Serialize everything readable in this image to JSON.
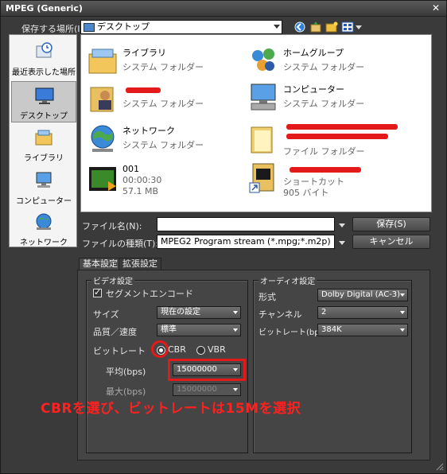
{
  "window": {
    "title": "MPEG (Generic)",
    "close_glyph": "✕"
  },
  "location": {
    "label": "保存する場所(I):",
    "value": "デスクトップ"
  },
  "places": [
    {
      "label": "最近表示した場所",
      "icon": "recent-places-icon"
    },
    {
      "label": "デスクトップ",
      "icon": "desktop-icon",
      "selected": true
    },
    {
      "label": "ライブラリ",
      "icon": "library-icon"
    },
    {
      "label": "コンピューター",
      "icon": "computer-icon"
    },
    {
      "label": "ネットワーク",
      "icon": "network-icon"
    }
  ],
  "files": [
    {
      "name": "ライブラリ",
      "type": "システム フォルダー",
      "icon": "library-icon"
    },
    {
      "name": "ホームグループ",
      "type": "システム フォルダー",
      "icon": "homegroup-icon"
    },
    {
      "name": "",
      "type": "システム フォルダー",
      "icon": "user-folder-icon",
      "redacted": true
    },
    {
      "name": "コンピューター",
      "type": "システム フォルダー",
      "icon": "computer-icon"
    },
    {
      "name": "ネットワーク",
      "type": "システム フォルダー",
      "icon": "network-icon"
    },
    {
      "name": "",
      "type": "ファイル フォルダー",
      "icon": "folder-icon",
      "redacted": true
    },
    {
      "name": "001",
      "type": "00:00:30",
      "size": "57.1 MB",
      "icon": "video-file-icon"
    },
    {
      "name": "",
      "type": "ショートカット",
      "size": "905 バイト",
      "icon": "shortcut-icon",
      "redacted": true
    }
  ],
  "filename": {
    "label": "ファイル名(N):",
    "value": ""
  },
  "filetype": {
    "label": "ファイルの種類(T):",
    "value": "MPEG2 Program stream (*.mpg;*.m2p)"
  },
  "buttons": {
    "save": "保存(S)",
    "cancel": "キャンセル"
  },
  "tabs": [
    {
      "label": "基本設定",
      "active": true
    },
    {
      "label": "拡張設定"
    }
  ],
  "video": {
    "group_title": "ビデオ設定",
    "segment_encode": "セグメントエンコード",
    "size_label": "サイズ",
    "size_value": "現在の設定",
    "quality_label": "品質／速度",
    "quality_value": "標準",
    "bitrate_label": "ビットレート",
    "cbr": "CBR",
    "vbr": "VBR",
    "avg_label": "平均(bps)",
    "avg_value": "15000000",
    "max_label": "最大(bps)",
    "max_value": "15000000"
  },
  "audio": {
    "group_title": "オーディオ設定",
    "format_label": "形式",
    "format_value": "Dolby Digital (AC-3)",
    "channel_label": "チャンネル",
    "channel_value": "2",
    "bitrate_label": "ビットレート(bps)",
    "bitrate_value": "384K"
  },
  "annotation": "CBRを選び、ビットレートは15Mを選択",
  "colors": {
    "annotation": "#e41a1a"
  }
}
